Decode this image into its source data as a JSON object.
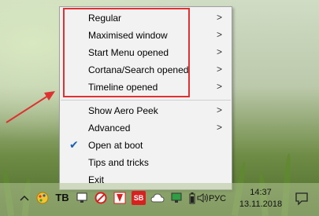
{
  "menu": {
    "items": [
      {
        "label": "Regular",
        "submenu": true
      },
      {
        "label": "Maximised window",
        "submenu": true
      },
      {
        "label": "Start Menu opened",
        "submenu": true
      },
      {
        "label": "Cortana/Search opened",
        "submenu": true
      },
      {
        "label": "Timeline opened",
        "submenu": true
      },
      {
        "label": "Show Aero Peek",
        "submenu": true
      },
      {
        "label": "Advanced",
        "submenu": true
      },
      {
        "label": "Open at boot",
        "checked": true
      },
      {
        "label": "Tips and tricks"
      },
      {
        "label": "Exit"
      }
    ],
    "arrow_glyph": ">",
    "check_glyph": "✔"
  },
  "taskbar": {
    "tray_icons": [
      "chevron-up-icon",
      "paint-icon",
      "tb-icon",
      "network-monitor-icon",
      "no-symbol-icon",
      "shield-flag-icon",
      "sb-icon",
      "cloud-icon",
      "security-monitor-icon",
      "battery-icon",
      "volume-icon"
    ],
    "tb_text": "TB",
    "sb_text": "SB",
    "language": "РУС",
    "time": "14:37",
    "date": "13.11.2018"
  },
  "colors": {
    "annotation_red": "#e03131",
    "menu_bg": "#f2f2f2",
    "check_blue": "#1a5fb4"
  }
}
